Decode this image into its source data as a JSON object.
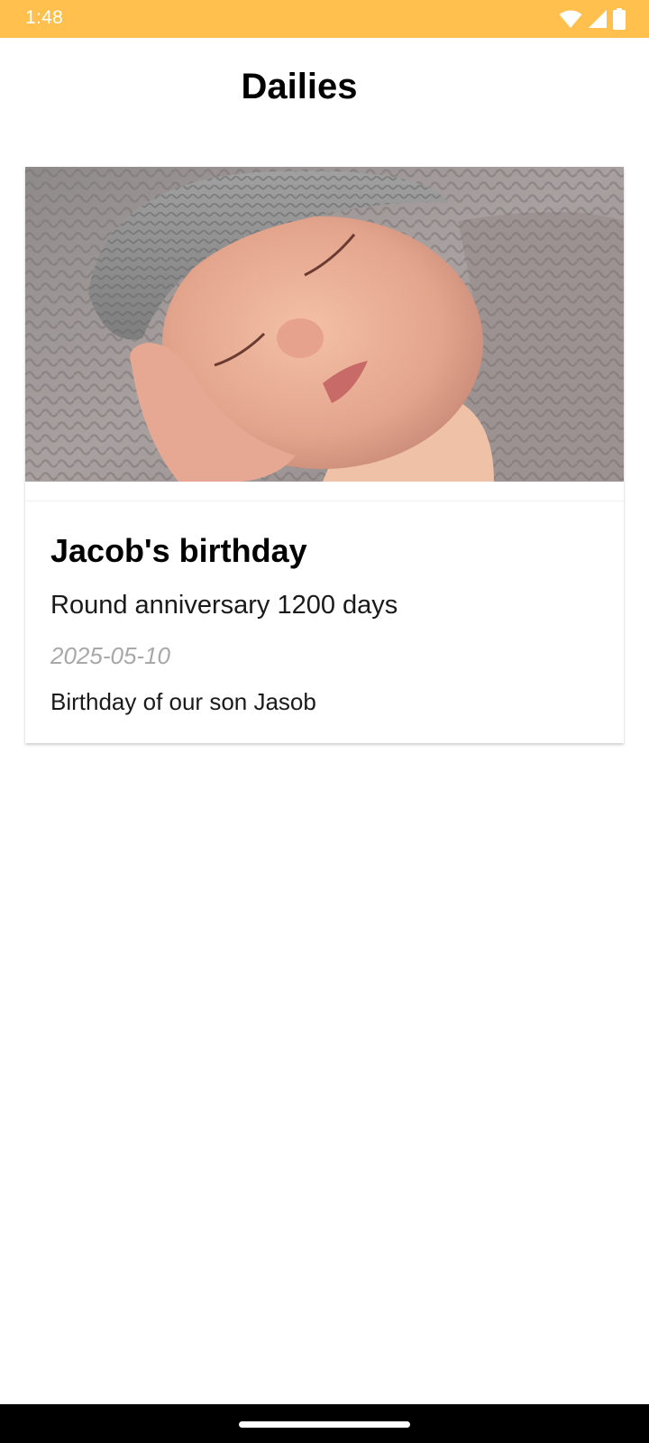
{
  "status_bar": {
    "time": "1:48",
    "background_color": "#FFC04D",
    "icons": [
      "wifi-icon",
      "cellular-signal-icon",
      "battery-icon"
    ]
  },
  "app_bar": {
    "title": "Dailies"
  },
  "entries": [
    {
      "image": "sleeping-newborn-photo",
      "title": "Jacob's birthday",
      "subtitle": "Round anniversary 1200 days",
      "date": "2025-05-10",
      "description": "Birthday of our son Jasob"
    }
  ],
  "nav_bar": {
    "home_indicator": "home-gesture-bar"
  }
}
